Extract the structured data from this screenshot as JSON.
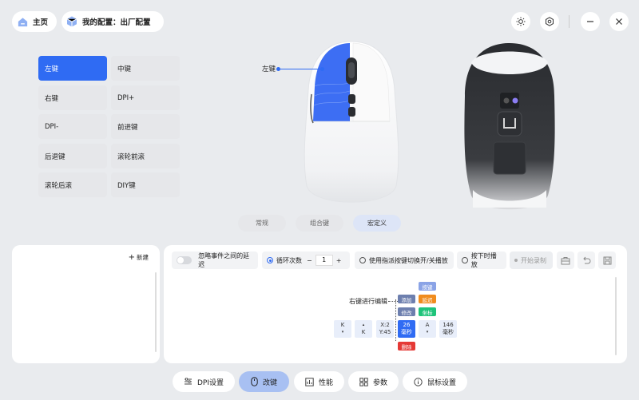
{
  "header": {
    "home_label": "主页",
    "config_label": "我的配置：出厂配置"
  },
  "keys": [
    {
      "label": "左键"
    },
    {
      "label": "中键"
    },
    {
      "label": "右键"
    },
    {
      "label": "DPI+"
    },
    {
      "label": "DPI-"
    },
    {
      "label": "前进键"
    },
    {
      "label": "后退键"
    },
    {
      "label": "滚轮前滚"
    },
    {
      "label": "滚轮后滚"
    },
    {
      "label": "DIY键"
    }
  ],
  "mouse_callout": "左键",
  "mode_tabs": [
    {
      "label": "常规"
    },
    {
      "label": "组合键"
    },
    {
      "label": "宏定义"
    }
  ],
  "macro_list": {
    "new_label": "新建"
  },
  "macro_controls": {
    "ignore_delay": "忽略事件之间的延迟",
    "loop_count_label": "循环次数",
    "loop_count_value": "1",
    "minus": "−",
    "plus": "+",
    "toggle_label": "使用指派按键切换开/关播放",
    "press_label": "按下时播放",
    "record_label": "开始录制"
  },
  "editor": {
    "hint": "右键进行编辑",
    "actions": {
      "key": "按键",
      "add": "添加",
      "delay": "延迟",
      "modify": "修改",
      "coord": "坐标",
      "delete": "删除"
    },
    "sequence": [
      {
        "top": "K",
        "bottom": "▾"
      },
      {
        "top": "▴",
        "bottom": "K"
      },
      {
        "top": "X:2",
        "bottom": "Y:45"
      },
      {
        "top": "26",
        "bottom": "毫秒"
      },
      {
        "top": "A",
        "bottom": "▾"
      },
      {
        "top": "146",
        "bottom": "毫秒"
      }
    ]
  },
  "bottom_nav": [
    {
      "label": "DPI设置"
    },
    {
      "label": "改键"
    },
    {
      "label": "性能"
    },
    {
      "label": "参数"
    },
    {
      "label": "鼠标设置"
    }
  ],
  "colors": {
    "accent": "#2f6bf3",
    "orange": "#f08c1e",
    "green": "#1ec47a",
    "red": "#e53935",
    "slate": "#6d7fae"
  }
}
